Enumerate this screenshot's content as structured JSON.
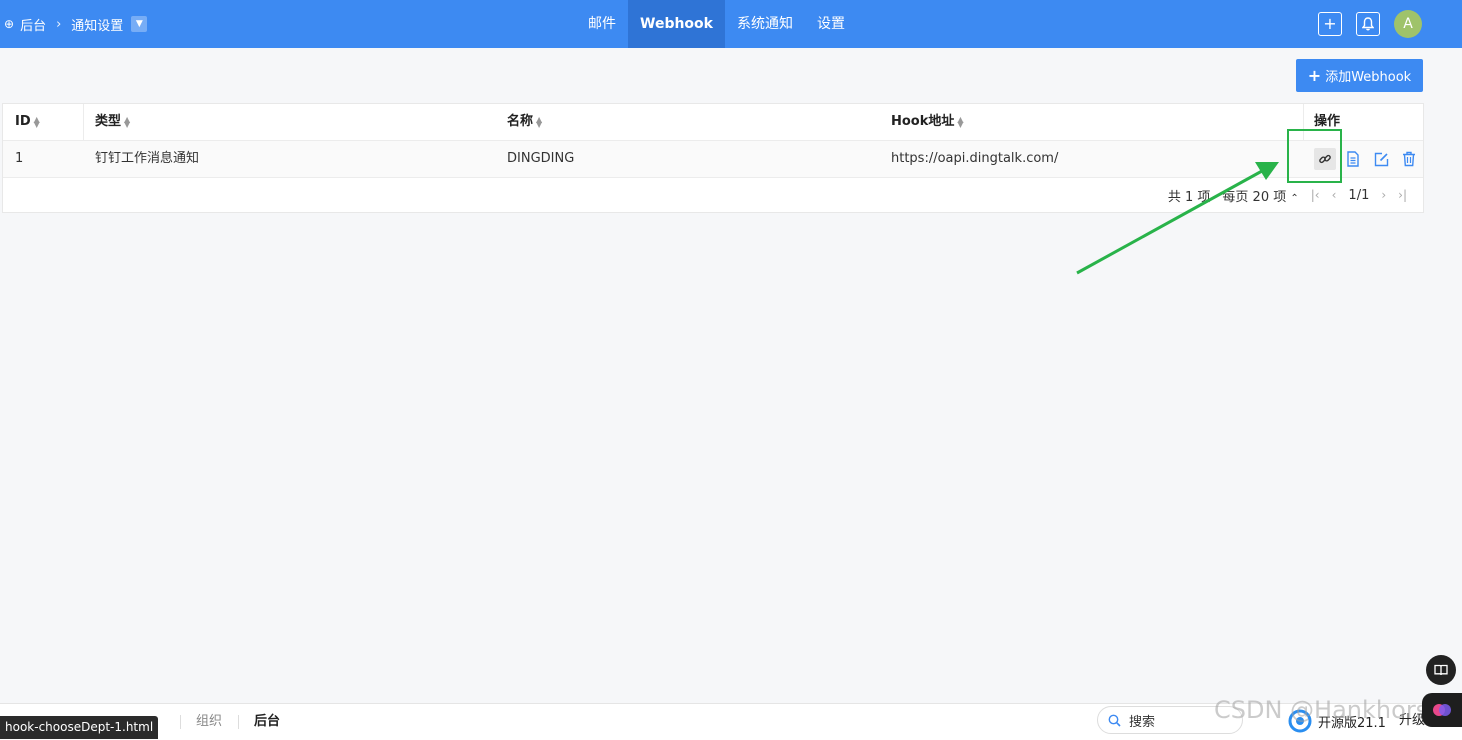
{
  "header": {
    "breadcrumb": {
      "root": "后台",
      "current": "通知设置"
    },
    "tabs": [
      {
        "label": "邮件"
      },
      {
        "label": "Webhook"
      },
      {
        "label": "系统通知"
      },
      {
        "label": "设置"
      }
    ],
    "active_tab": "Webhook",
    "avatar_initial": "A"
  },
  "toolbar": {
    "add_label": "添加Webhook"
  },
  "table": {
    "columns": [
      "ID",
      "类型",
      "名称",
      "Hook地址",
      "操作"
    ],
    "rows": [
      {
        "id": "1",
        "type": "钉钉工作消息通知",
        "name": "DINGDING",
        "url": "https://oapi.dingtalk.com/"
      }
    ]
  },
  "pager": {
    "total": "共 1 项",
    "per_page": "每页 20 项",
    "page": "1/1"
  },
  "footer": {
    "tabs": [
      "组织",
      "后台"
    ],
    "status_url": "hook-chooseDept-1.html",
    "search_placeholder": "搜索",
    "edition": "开源版21.1",
    "upgrade": "升级",
    "watermark": "CSDN @Hankhorse"
  },
  "colors": {
    "header": "#3d8af2",
    "active_tab": "#2f74d6",
    "highlight": "#29b34a",
    "icon": "#3d8af2"
  }
}
